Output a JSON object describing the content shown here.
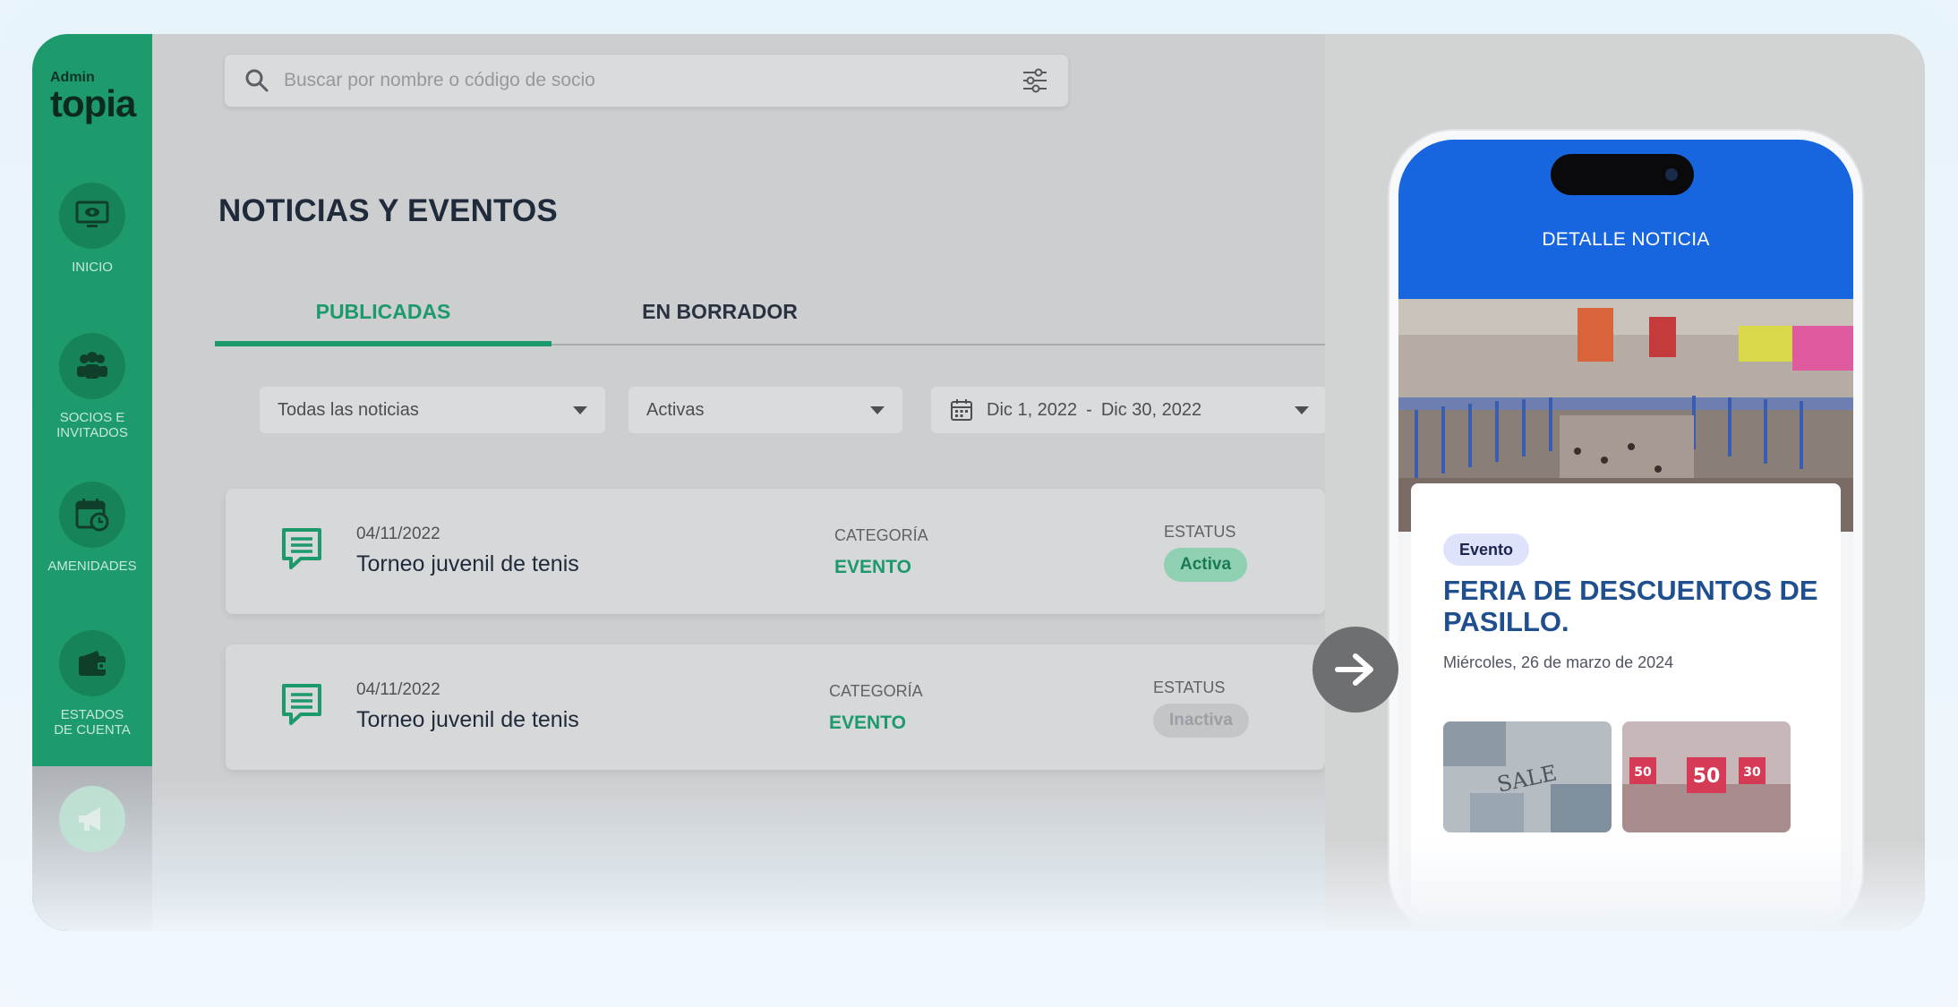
{
  "app": {
    "logo_small": "Admin",
    "logo_big": "topia"
  },
  "sidebar": {
    "items": [
      {
        "label": "INICIO",
        "icon": "monitor-icon"
      },
      {
        "label": "SOCIOS E\nINVITADOS",
        "icon": "users-icon"
      },
      {
        "label": "AMENIDADES",
        "icon": "calendar-clock-icon"
      },
      {
        "label": "ESTADOS\nDE CUENTA",
        "icon": "wallet-icon"
      },
      {
        "label": "",
        "icon": "megaphone-icon"
      }
    ]
  },
  "search": {
    "placeholder": "Buscar por nombre o código de socio"
  },
  "page": {
    "title": "NOTICIAS Y EVENTOS"
  },
  "tabs": [
    {
      "label": "PUBLICADAS",
      "active": true
    },
    {
      "label": "EN BORRADOR",
      "active": false
    }
  ],
  "filters": {
    "type": "Todas las noticias",
    "status": "Activas",
    "date_start": "Dic 1, 2022",
    "date_sep": "-",
    "date_end": "Dic 30, 2022"
  },
  "news": [
    {
      "date": "04/11/2022",
      "title": "Torneo juvenil de tenis",
      "category_label": "CATEGORÍA",
      "category": "EVENTO",
      "status_label": "ESTATUS",
      "status": "Activa"
    },
    {
      "date": "04/11/2022",
      "title": "Torneo juvenil de tenis",
      "category_label": "CATEGORÍA",
      "category": "EVENTO",
      "status_label": "ESTATUS",
      "status": "Inactiva"
    }
  ],
  "phone": {
    "header_title": "DETALLE NOTICIA",
    "tag": "Evento",
    "news_title": "FERIA DE DESCUENTOS DE PASILLO.",
    "news_date": "Miércoles, 26 de marzo de 2024"
  },
  "colors": {
    "brand_green": "#1e9b6c",
    "phone_blue": "#1766e0",
    "title_blue": "#1f4f8f"
  }
}
